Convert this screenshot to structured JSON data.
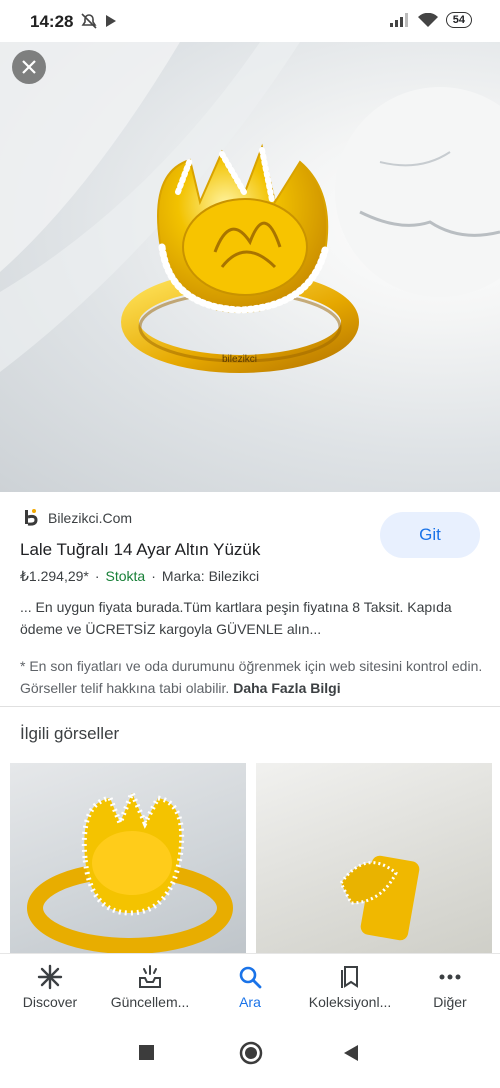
{
  "status_bar": {
    "time": "14:28",
    "battery": "54"
  },
  "hero": {
    "engraving": "bilezikci"
  },
  "result": {
    "source": "Bilezikci.Com",
    "go_button": "Git",
    "title": "Lale Tuğralı 14 Ayar Altın Yüzük",
    "price": "₺1.294,29*",
    "stock": "Stokta",
    "brand": "Marka: Bilezikci",
    "description": "... En uygun fiyata burada.Tüm kartlara peşin fiyatına 8 Taksit. Kapıda ödeme ve ÜCRETSİZ kargoyla GÜVENLE alın...",
    "note": "* En son fiyatları ve oda durumunu öğrenmek için web sitesini kontrol edin. Görseller telif hakkına tabi olabilir.",
    "more_info": "Daha Fazla Bilgi"
  },
  "related": {
    "title": "İlgili görseller"
  },
  "bottom_nav": {
    "items": [
      {
        "label": "Discover",
        "icon": "asterisk-icon"
      },
      {
        "label": "Güncellem...",
        "icon": "updates-icon"
      },
      {
        "label": "Ara",
        "icon": "search-icon"
      },
      {
        "label": "Koleksiyonl...",
        "icon": "collections-icon"
      },
      {
        "label": "Diğer",
        "icon": "more-icon"
      }
    ],
    "active_index": 2
  },
  "colors": {
    "accent": "#1a73e8",
    "stock_green": "#188038",
    "gold": "#f2c200"
  }
}
